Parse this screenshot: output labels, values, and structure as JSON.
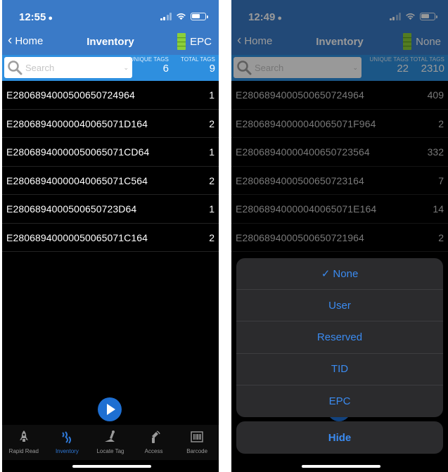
{
  "colors": {
    "nav_blue": "#3a7ac7",
    "search_row_blue": "#2e8fdf",
    "accent": "#2f78d6",
    "sheet_text": "#3b8bf0"
  },
  "left": {
    "status_time": "12:55",
    "nav": {
      "back_label": "Home",
      "title": "Inventory",
      "memory_bank": "EPC"
    },
    "search": {
      "placeholder": "Search"
    },
    "stats": {
      "unique_label": "UNIQUE TAGS",
      "unique_value": "6",
      "total_label": "TOTAL TAGS",
      "total_value": "9"
    },
    "tags": [
      {
        "epc": "E2806894000500650724964",
        "count": "1"
      },
      {
        "epc": "E28068940000040065071D164",
        "count": "2"
      },
      {
        "epc": "E28068940000050065071CD64",
        "count": "1"
      },
      {
        "epc": "E28068940000040065071C564",
        "count": "2"
      },
      {
        "epc": "E2806894000500650723D64",
        "count": "1"
      },
      {
        "epc": "E28068940000050065071C164",
        "count": "2"
      }
    ],
    "tabs": [
      {
        "label": "Rapid Read",
        "icon": "rocket-icon"
      },
      {
        "label": "Inventory",
        "icon": "rfid-waves-icon",
        "active": true
      },
      {
        "label": "Locate Tag",
        "icon": "locate-icon"
      },
      {
        "label": "Access",
        "icon": "access-scanner-icon"
      },
      {
        "label": "Barcode",
        "icon": "barcode-icon"
      }
    ]
  },
  "right": {
    "status_time": "12:49",
    "nav": {
      "back_label": "Home",
      "title": "Inventory",
      "memory_bank": "None"
    },
    "search": {
      "placeholder": "Search"
    },
    "stats": {
      "unique_label": "UNIQUE TAGS",
      "unique_value": "22",
      "total_label": "TOTAL TAGS",
      "total_value": "2310"
    },
    "tags": [
      {
        "epc": "E2806894000500650724964",
        "count": "409"
      },
      {
        "epc": "E28068940000040065071F964",
        "count": "2"
      },
      {
        "epc": "E28068940000400650723564",
        "count": "332"
      },
      {
        "epc": "E2806894000500650723164",
        "count": "7"
      },
      {
        "epc": "E28068940000040065071E164",
        "count": "14"
      },
      {
        "epc": "E2806894000500650721964",
        "count": "2"
      }
    ],
    "action_sheet": {
      "options": [
        "✓ None",
        "User",
        "Reserved",
        "TID",
        "EPC"
      ],
      "hide_label": "Hide"
    }
  }
}
